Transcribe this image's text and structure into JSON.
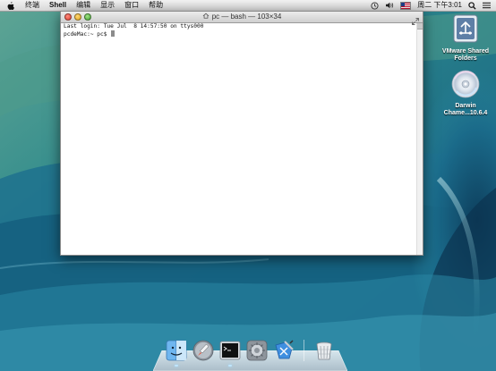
{
  "menubar": {
    "items": [
      "终端",
      "Shell",
      "编辑",
      "显示",
      "窗口",
      "帮助"
    ],
    "clock": "周二 下午3:01",
    "icons": [
      "apple-icon",
      "time-machine-icon",
      "volume-icon",
      "input-flag-icon",
      "search-icon",
      "list-icon"
    ]
  },
  "window": {
    "title": "pc — bash — 103×34",
    "lines": [
      "Last login: Tue Jul  8 14:57:50 on ttys000",
      "pcdeMac:~ pc$ "
    ]
  },
  "desktop_icons": [
    {
      "label_line1": "VMware Shared",
      "label_line2": "Folders"
    },
    {
      "label_line1": "Darwin",
      "label_line2": "Chame...10.6.4"
    }
  ],
  "dock": {
    "items": [
      "finder-icon",
      "launchpad-icon",
      "terminal-icon",
      "system-preferences-icon",
      "xcode-icon",
      "trash-icon"
    ]
  },
  "colors": {
    "wave_dark": "#0e3f5a",
    "wave_light": "#4fa7b7",
    "accent_green": "#5ea28a"
  }
}
